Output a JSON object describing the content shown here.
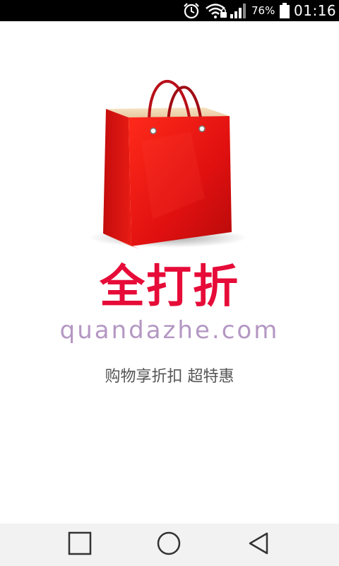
{
  "status_bar": {
    "icons": [
      "alarm-icon",
      "wifi-icon",
      "signal-icon",
      "battery-icon"
    ],
    "battery_percent": "76%",
    "time": "01:16"
  },
  "splash": {
    "logo_icon": "shopping-bag-icon",
    "app_name": "全打折",
    "domain": "quandazhe.com",
    "tagline": "购物享折扣 超特惠",
    "colors": {
      "brand_red": "#e60b38",
      "domain_purple": "#b497c3",
      "tagline_gray": "#555555"
    }
  },
  "nav_bar": {
    "buttons": [
      "recent-apps-icon",
      "home-icon",
      "back-icon"
    ]
  }
}
